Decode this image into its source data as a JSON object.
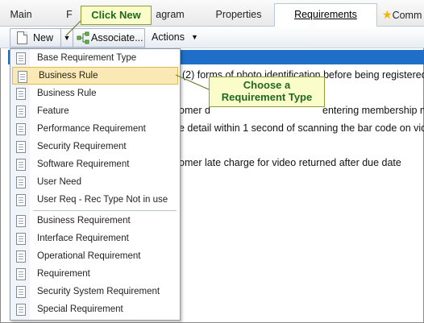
{
  "tabs": [
    {
      "key": "main",
      "label": "Main"
    },
    {
      "key": "f",
      "label": "F"
    },
    {
      "key": "gram",
      "label": "agram"
    },
    {
      "key": "props",
      "label": "Properties"
    },
    {
      "key": "req",
      "label": "Requirements"
    },
    {
      "key": "comm",
      "label": "Comm"
    }
  ],
  "toolbar": {
    "new_label": "New",
    "associate_label": "Associate...",
    "actions_label": "Actions"
  },
  "rows": [
    {
      "text": "(2) forms of photo identification before being registered"
    },
    {
      "text": "omer d"
    },
    {
      "text": "entering membership n"
    },
    {
      "text": "e detail within 1 second of scanning the bar code on vide"
    },
    {
      "text": "omer late charge for video returned after due date"
    }
  ],
  "menu": {
    "items_top": [
      "Base Requirement Type",
      "Business Rule",
      "Business Rule",
      "Feature",
      "Performance Requirement",
      "Security Requirement",
      "Software Requirement",
      "User Need",
      "User Req - Rec Type Not in use"
    ],
    "items_bottom": [
      "Business Requirement",
      "Interface Requirement",
      "Operational Requirement",
      "Requirement",
      "Security System Requirement",
      "Special Requirement"
    ],
    "selected_index": 1
  },
  "callouts": {
    "click_new": "Click New",
    "choose_line1": "Choose a",
    "choose_line2": "Requirement Type"
  },
  "icons": {
    "new": "document-icon",
    "associate": "associate-icon",
    "menu_item": "requirement-doc-icon",
    "comm": "star-icon"
  },
  "colors": {
    "accent": "#1f6fc8",
    "callout_bg": "#fafcc9",
    "callout_text": "#1f6a1f",
    "selected_bg": "#fbe9b5"
  }
}
